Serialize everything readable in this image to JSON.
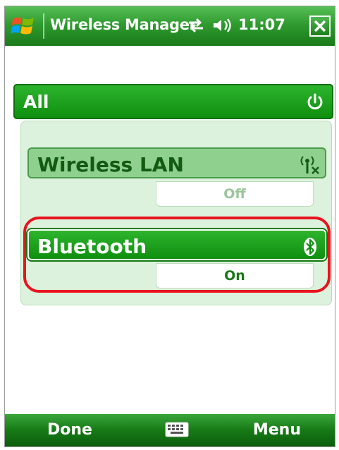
{
  "window": {
    "title": "Wireless Manager",
    "time": "11:07",
    "close_icon": "close-x-icon",
    "start_icon": "windows-flag-icon",
    "connectivity_icon": "connectivity-icon",
    "volume_icon": "volume-icon"
  },
  "all": {
    "label": "All",
    "icon": "power-icon"
  },
  "radios": [
    {
      "label": "Wireless LAN",
      "status": "Off",
      "icon": "wifi-off-icon"
    },
    {
      "label": "Bluetooth",
      "status": "On",
      "icon": "bluetooth-icon"
    }
  ],
  "softkeys": {
    "left": "Done",
    "right": "Menu",
    "center_icon": "keyboard-icon"
  },
  "colors": {
    "accent": "#1a9a1a",
    "highlight": "#e8141e"
  }
}
